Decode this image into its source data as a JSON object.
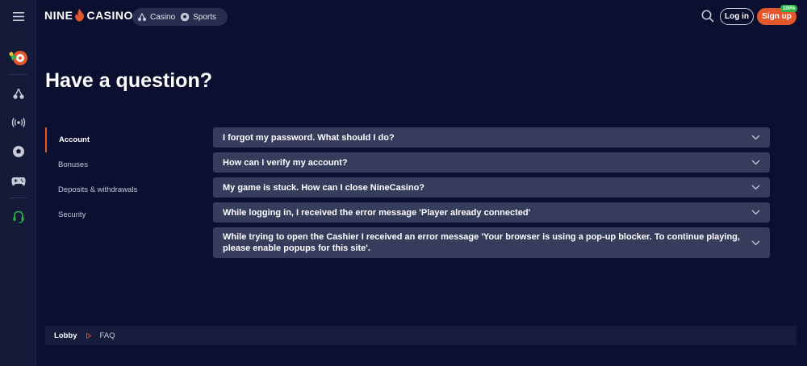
{
  "header": {
    "logo_left": "NINE",
    "logo_right": "CASINO",
    "nav": [
      {
        "label": "Casino",
        "icon": "cherries-icon"
      },
      {
        "label": "Sports",
        "icon": "football-icon"
      }
    ],
    "login_label": "Log in",
    "signup_label": "Sign up",
    "signup_badge": "100%"
  },
  "sidebar": {
    "items": [
      {
        "icon": "menu-icon"
      },
      {
        "icon": "wheel-of-fortune-icon"
      },
      {
        "icon": "cherries-icon"
      },
      {
        "icon": "live-broadcast-icon"
      },
      {
        "icon": "football-icon"
      },
      {
        "icon": "gamepad-icon"
      },
      {
        "icon": "support-headset-icon"
      }
    ]
  },
  "page": {
    "title": "Have a question?"
  },
  "categories": [
    {
      "label": "Account",
      "active": true
    },
    {
      "label": "Bonuses",
      "active": false
    },
    {
      "label": "Deposits & withdrawals",
      "active": false
    },
    {
      "label": "Security",
      "active": false
    }
  ],
  "faq": [
    {
      "question": "I forgot my password. What should I do?"
    },
    {
      "question": "How can I verify my account?"
    },
    {
      "question": "My game is stuck. How can I close NineCasino?"
    },
    {
      "question": "While logging in, I received the error message 'Player already connected'"
    },
    {
      "question": "While trying to open the Cashier I received an error message 'Your browser is using a pop-up blocker. To continue playing, please enable popups for this site'."
    }
  ],
  "breadcrumb": {
    "home": "Lobby",
    "current": "FAQ"
  },
  "colors": {
    "background": "#0b1030",
    "accent": "#e2572e",
    "faq_row": "#363c5b",
    "badge_green": "#2db34a"
  }
}
